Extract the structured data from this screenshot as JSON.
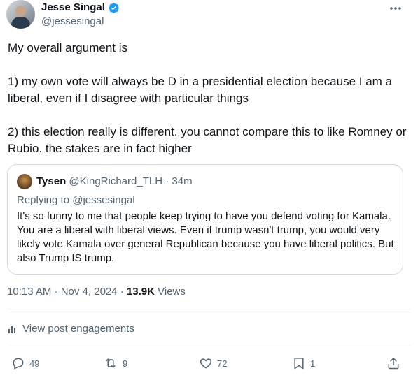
{
  "author": {
    "display_name": "Jesse Singal",
    "handle": "@jessesingal",
    "verified_icon": "verified-badge-icon"
  },
  "tweet": {
    "text": "My overall argument is\n\n1) my own vote will always be D in a presidential election because I am a liberal, even if I disagree with particular things\n\n2) this election really is different. you cannot compare this to like Romney or Rubio. the stakes are in fact higher"
  },
  "quote": {
    "display_name": "Tysen",
    "handle": "@KingRichard_TLH",
    "time": "· 34m",
    "replying_to_prefix": "Replying to ",
    "replying_to_handle": "@jessesingal",
    "text": "It's so funny to me that people keep trying to have you defend voting for Kamala. You are a liberal with liberal views. Even if trump wasn't trump, you would very likely vote Kamala over general Republican because you have liberal politics. But also Trump IS trump."
  },
  "meta": {
    "timestamp": "10:13 AM · Nov 4, 2024 · ",
    "views_count": "13.9K",
    "views_label": " Views"
  },
  "engagements": {
    "label": "View post engagements"
  },
  "actions": {
    "replies": "49",
    "reposts": "9",
    "likes": "72",
    "bookmarks": "1"
  },
  "colors": {
    "accent": "#1d9bf0",
    "muted": "#536471",
    "text": "#0f1419",
    "border": "#cfd9de"
  }
}
